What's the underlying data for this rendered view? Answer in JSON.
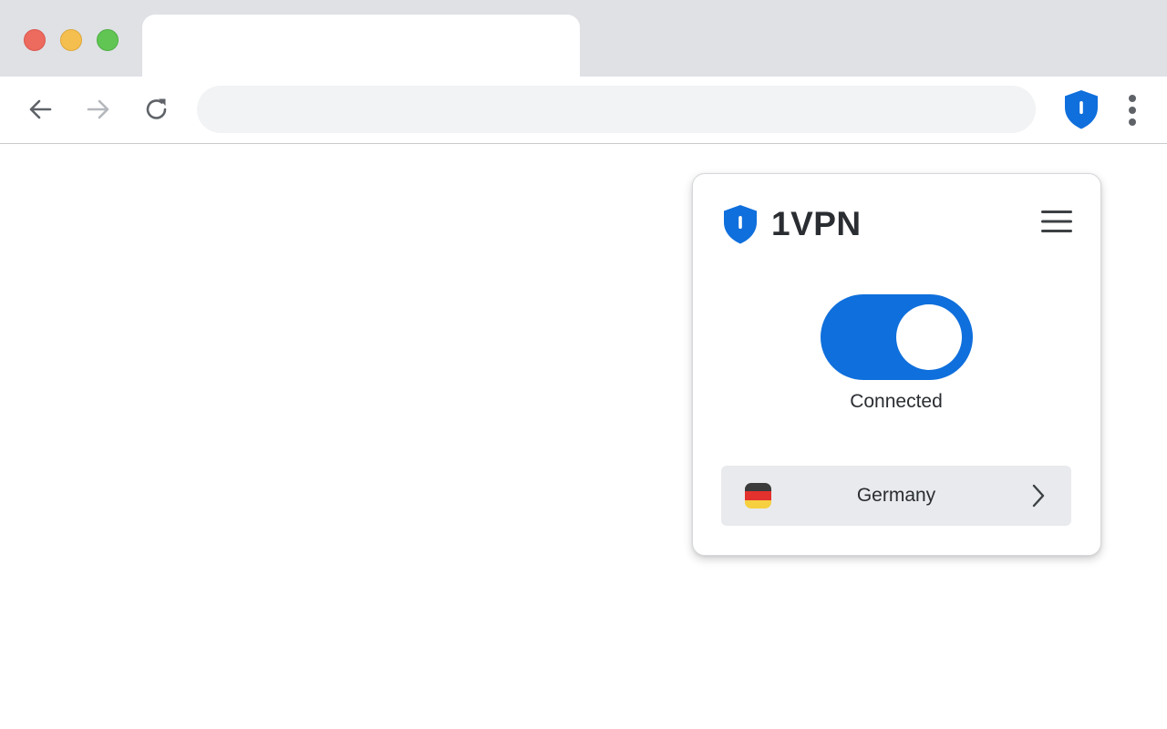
{
  "browser": {
    "tab": {
      "title": ""
    },
    "address_bar": {
      "value": "",
      "placeholder": ""
    },
    "icons": {
      "back": "arrow-left-icon",
      "forward": "arrow-right-icon",
      "reload": "reload-icon",
      "extension": "shield-icon",
      "menu": "vertical-dots-icon"
    },
    "colors": {
      "tabstrip": "#dfe1e5",
      "close": "#ed6a5e",
      "minimize": "#f5bf4f",
      "maximize": "#61c554"
    }
  },
  "vpn_popup": {
    "brand_name": "1VPN",
    "status": "Connected",
    "connected": true,
    "location": {
      "country": "Germany",
      "flag_colors": [
        "#3b3b3b",
        "#e3312d",
        "#f6d03f"
      ]
    },
    "colors": {
      "accent": "#0f6fdc"
    }
  }
}
